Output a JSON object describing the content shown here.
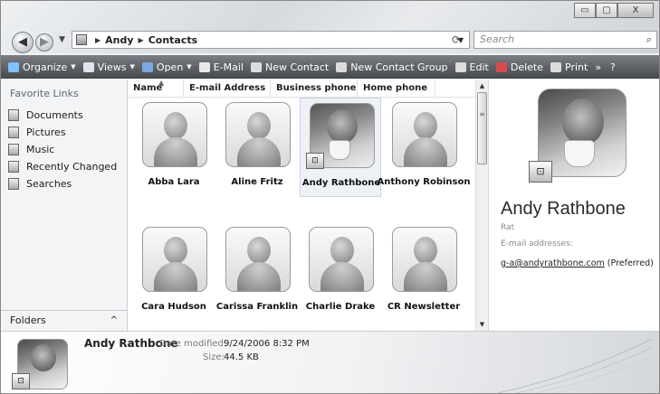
{
  "window": {
    "controls": {
      "minimize": "▭",
      "maximize": "▢",
      "close": "X"
    }
  },
  "nav": {
    "back": "◀",
    "forward": "▶",
    "recent_drop": "▼",
    "address": {
      "crumbs": [
        "Andy",
        "Contacts"
      ],
      "separator": "▶",
      "dropdown": "▼",
      "refresh": "⟳"
    },
    "search": {
      "placeholder": "Search",
      "icon": "⌕"
    }
  },
  "toolbar": {
    "items": [
      {
        "label": "Organize",
        "icon": "organize-icon",
        "color": "#7fc0ff",
        "has_dropdown": true
      },
      {
        "label": "Views",
        "icon": "views-icon",
        "color": "#dfe6ef",
        "has_dropdown": true
      },
      {
        "label": "Open",
        "icon": "open-icon",
        "color": "#7aa7e0",
        "has_dropdown": true
      },
      {
        "label": "E-Mail",
        "icon": "email-icon",
        "color": "#e9e9e9",
        "has_dropdown": false
      },
      {
        "label": "New Contact",
        "icon": "new-contact-icon",
        "color": "#dcdcdc",
        "has_dropdown": false
      },
      {
        "label": "New Contact Group",
        "icon": "new-group-icon",
        "color": "#dcdcdc",
        "has_dropdown": false
      },
      {
        "label": "Edit",
        "icon": "edit-icon",
        "color": "#dcdcdc",
        "has_dropdown": false
      },
      {
        "label": "Delete",
        "icon": "delete-icon",
        "color": "#d84a4a",
        "has_dropdown": false
      },
      {
        "label": "Print",
        "icon": "print-icon",
        "color": "#dcdcdc",
        "has_dropdown": false
      }
    ],
    "overflow": "»",
    "help": "?"
  },
  "sidebar": {
    "title": "Favorite Links",
    "links": [
      {
        "label": "Documents",
        "icon": "documents-icon"
      },
      {
        "label": "Pictures",
        "icon": "pictures-icon"
      },
      {
        "label": "Music",
        "icon": "music-icon"
      },
      {
        "label": "Recently Changed",
        "icon": "recently-changed-icon"
      },
      {
        "label": "Searches",
        "icon": "searches-icon"
      }
    ],
    "folders_label": "Folders",
    "folders_caret": "^"
  },
  "columns": [
    {
      "label": "Name",
      "sort": "▲"
    },
    {
      "label": "E-mail Address"
    },
    {
      "label": "Business phone"
    },
    {
      "label": "Home phone"
    }
  ],
  "contacts": [
    {
      "name": "Abba Lara",
      "photo": "silhouette"
    },
    {
      "name": "Aline Fritz",
      "photo": "silhouette"
    },
    {
      "name": "Andy Rathbone",
      "photo": "real",
      "selected": true
    },
    {
      "name": "Anthony Robinson",
      "photo": "silhouette"
    },
    {
      "name": "Cara Hudson",
      "photo": "silhouette"
    },
    {
      "name": "Carissa Franklin",
      "photo": "silhouette"
    },
    {
      "name": "Charlie Drake",
      "photo": "silhouette"
    },
    {
      "name": "CR Newsletter",
      "photo": "silhouette"
    }
  ],
  "preview": {
    "name": "Andy Rathbone",
    "nickname": "Rat",
    "email_label": "E-mail addresses:",
    "email": "g-a@andyrathbone.com",
    "email_note": "(Preferred)"
  },
  "details": {
    "name": "Andy Rathbone",
    "modified_label": "Date modified:",
    "modified_value": "9/24/2006 8:32 PM",
    "size_label": "Size:",
    "size_value": "44.5 KB"
  },
  "scrollbar": {
    "up": "▲",
    "down": "▼",
    "grip": "≡"
  }
}
